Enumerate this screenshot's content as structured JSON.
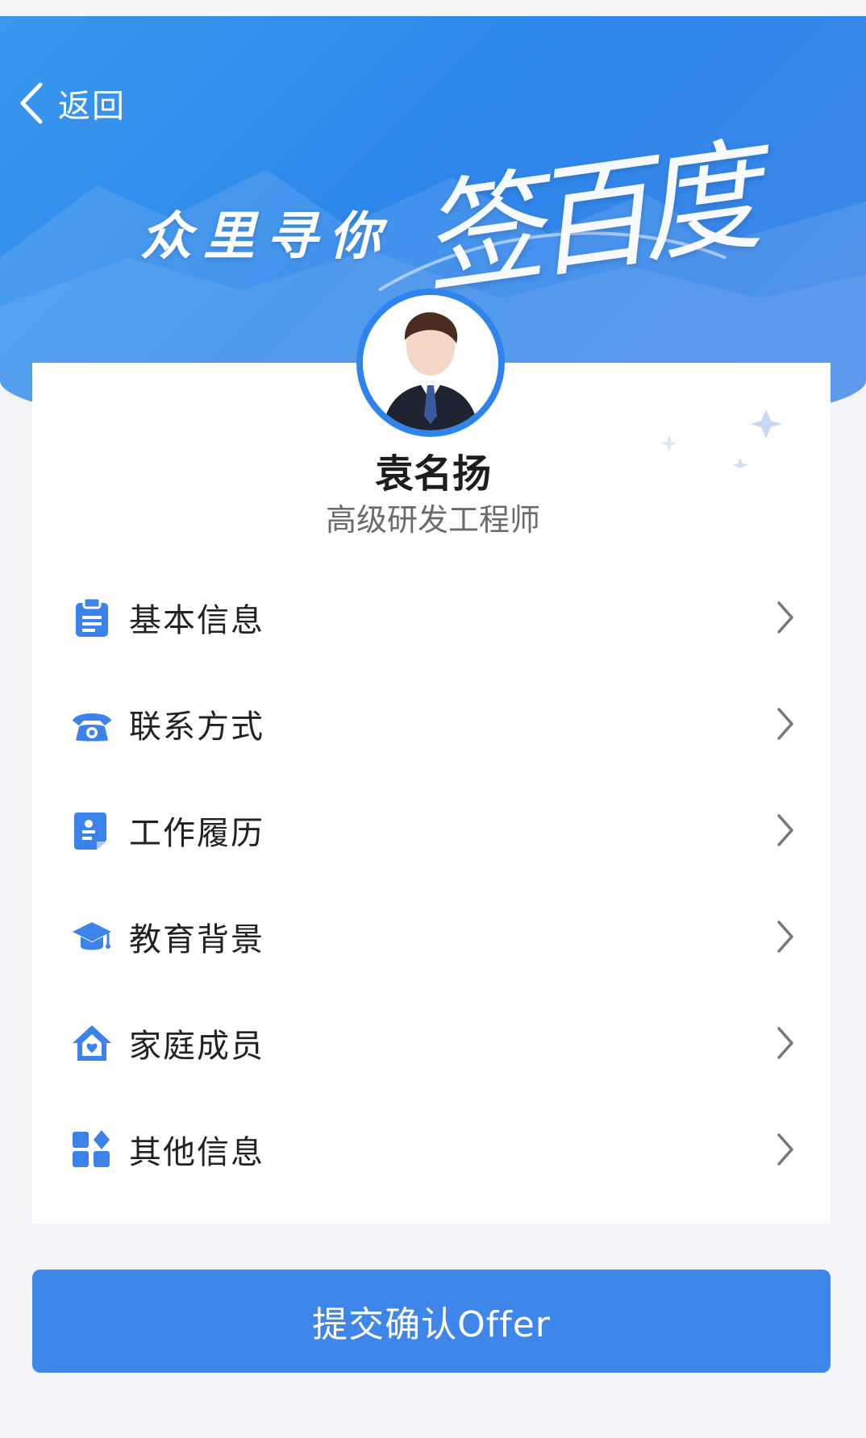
{
  "nav": {
    "back_label": "返回"
  },
  "banner": {
    "slogan": "众里寻你",
    "brush_text": "签百度"
  },
  "profile": {
    "name": "袁名扬",
    "title": "高级研发工程师"
  },
  "menu": {
    "items": [
      {
        "label": "基本信息",
        "icon": "clipboard-icon"
      },
      {
        "label": "联系方式",
        "icon": "phone-icon"
      },
      {
        "label": "工作履历",
        "icon": "resume-icon"
      },
      {
        "label": "教育背景",
        "icon": "graduation-cap-icon"
      },
      {
        "label": "家庭成员",
        "icon": "home-heart-icon"
      },
      {
        "label": "其他信息",
        "icon": "grid-icon"
      }
    ]
  },
  "actions": {
    "submit_label": "提交确认Offer"
  },
  "colors": {
    "primary": "#3e86ea",
    "banner": "#2d86ea",
    "icon": "#3b82ea"
  }
}
